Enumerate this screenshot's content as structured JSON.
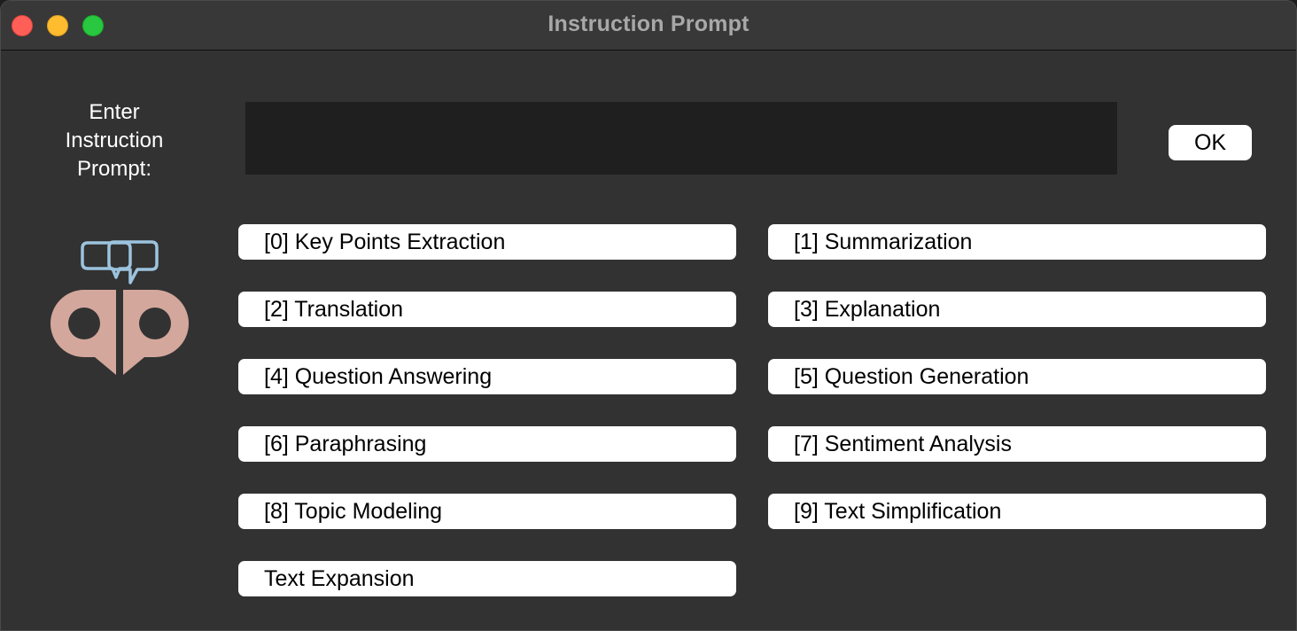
{
  "window": {
    "title": "Instruction Prompt"
  },
  "prompt": {
    "label": "Enter\nInstruction\nPrompt:",
    "value": "",
    "placeholder": ""
  },
  "ok_button": {
    "label": "OK"
  },
  "options": [
    {
      "label": "[0] Key Points Extraction"
    },
    {
      "label": "[1] Summarization"
    },
    {
      "label": "[2] Translation"
    },
    {
      "label": "[3] Explanation"
    },
    {
      "label": "[4] Question Answering"
    },
    {
      "label": "[5] Question Generation"
    },
    {
      "label": "[6] Paraphrasing"
    },
    {
      "label": "[7] Sentiment Analysis"
    },
    {
      "label": "[8] Topic Modeling"
    },
    {
      "label": "[9] Text Simplification"
    },
    {
      "label": "Text Expansion"
    }
  ],
  "logo": {
    "icon": "speech-bubbles-ap-logo",
    "colors": {
      "bubbles": "#9cc3de",
      "letters": "#d4a79c"
    }
  }
}
